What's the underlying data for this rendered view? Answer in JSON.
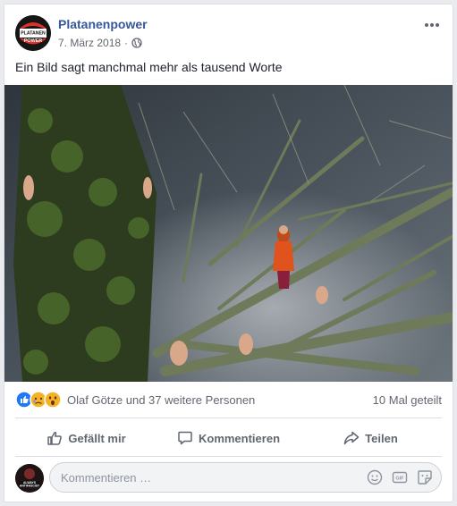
{
  "post": {
    "page_name": "Platanenpower",
    "date": "7. März 2018",
    "text": "Ein Bild sagt manchmal mehr als tausend Worte",
    "avatar_logo_text": [
      "PLATANEN",
      "POWER"
    ]
  },
  "reactions": {
    "icons": [
      "like-icon",
      "sad-icon",
      "wow-icon"
    ],
    "colors": {
      "like": "#2078f4",
      "sad": "#f7b125",
      "wow": "#f7b125"
    },
    "names": "Olaf Götze und 37 weitere Personen",
    "shares": "10 Mal geteilt"
  },
  "actions": {
    "like": "Gefällt mir",
    "comment": "Kommentieren",
    "share": "Teilen"
  },
  "comment_box": {
    "placeholder": "Kommentieren …",
    "user_avatar_text": "ALWAYS ANTIFASCIST"
  },
  "colors": {
    "link": "#365899",
    "secondary_text": "#616770",
    "action_text": "#606770"
  }
}
